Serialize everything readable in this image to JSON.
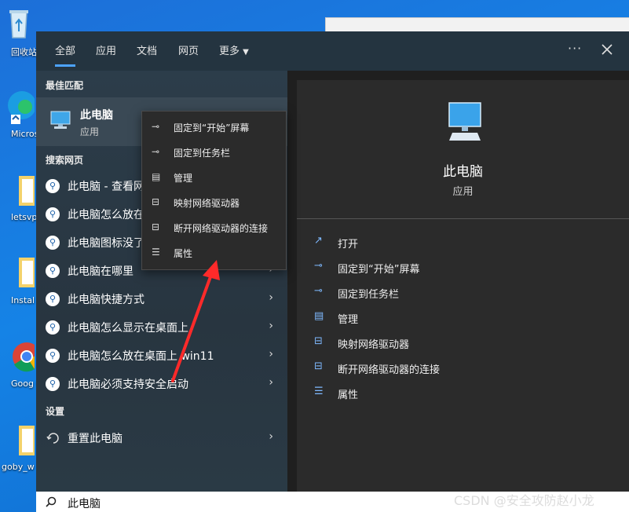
{
  "desktop": {
    "icons": [
      {
        "label": "回收站"
      },
      {
        "label": "Micros Edg"
      },
      {
        "label": "letsvp"
      },
      {
        "label": "Instal"
      },
      {
        "label": "Goog Chron"
      },
      {
        "label": "goby_w"
      }
    ]
  },
  "search_panel": {
    "tabs": [
      {
        "label": "全部"
      },
      {
        "label": "应用"
      },
      {
        "label": "文档"
      },
      {
        "label": "网页"
      },
      {
        "label": "更多"
      }
    ],
    "more_menu_icon": "ellipsis-icon",
    "close_icon": "close-icon",
    "best_match_header": "最佳匹配",
    "best_match": {
      "title": "此电脑",
      "subtitle": "应用"
    },
    "web_header": "搜索网页",
    "web_results": [
      {
        "text": "此电脑 - 查看网"
      },
      {
        "text": "此电脑怎么放在"
      },
      {
        "text": "此电脑图标没了"
      },
      {
        "text": "此电脑在哪里"
      },
      {
        "text": "此电脑快捷方式"
      },
      {
        "text": "此电脑怎么显示在桌面上"
      },
      {
        "text": "此电脑怎么放在桌面上 win11"
      },
      {
        "text": "此电脑必须支持安全启动"
      }
    ],
    "settings_header": "设置",
    "settings_results": [
      {
        "text": "重置此电脑"
      }
    ]
  },
  "context_menu": {
    "items": [
      {
        "label": "固定到“开始”屏幕",
        "icon": "pin-icon"
      },
      {
        "label": "固定到任务栏",
        "icon": "pin-icon"
      },
      {
        "label": "管理",
        "icon": "manage-icon"
      },
      {
        "label": "映射网络驱动器",
        "icon": "network-drive-icon"
      },
      {
        "label": "断开网络驱动器的连接",
        "icon": "network-drive-icon"
      },
      {
        "label": "属性",
        "icon": "properties-icon"
      }
    ]
  },
  "preview": {
    "title": "此电脑",
    "subtitle": "应用",
    "actions": [
      {
        "label": "打开",
        "icon": "open-icon"
      },
      {
        "label": "固定到“开始”屏幕",
        "icon": "pin-icon"
      },
      {
        "label": "固定到任务栏",
        "icon": "pin-icon"
      },
      {
        "label": "管理",
        "icon": "manage-icon"
      },
      {
        "label": "映射网络驱动器",
        "icon": "network-drive-icon"
      },
      {
        "label": "断开网络驱动器的连接",
        "icon": "network-drive-icon"
      },
      {
        "label": "属性",
        "icon": "properties-icon"
      }
    ]
  },
  "search_box": {
    "value": "此电脑"
  },
  "watermark": "CSDN @安全攻防赵小龙",
  "colors": {
    "accent": "#4da3ff",
    "arrow": "#ff2a2a"
  }
}
